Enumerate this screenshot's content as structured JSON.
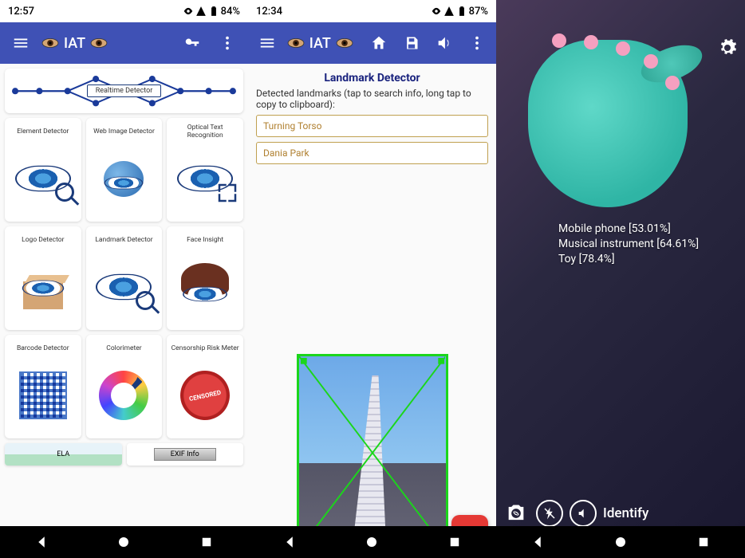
{
  "panel_left": {
    "status": {
      "time": "12:57",
      "battery": "84%"
    },
    "app_bar": {
      "title": "IAT"
    },
    "realtime": {
      "label": "Realtime Detector"
    },
    "cards": [
      {
        "title": "Element Detector"
      },
      {
        "title": "Web Image Detector"
      },
      {
        "title": "Optical Text Recognition"
      },
      {
        "title": "Logo Detector"
      },
      {
        "title": "Landmark Detector"
      },
      {
        "title": "Face Insight"
      },
      {
        "title": "Barcode Detector"
      },
      {
        "title": "Colorimeter"
      },
      {
        "title": "Censorship Risk Meter"
      }
    ],
    "bottom": [
      {
        "label": "ELA"
      },
      {
        "label": "EXIF Info"
      }
    ]
  },
  "panel_mid": {
    "status": {
      "time": "12:34",
      "battery": "87%"
    },
    "app_bar": {
      "title": "IAT"
    },
    "section_title": "Landmark Detector",
    "subtitle": "Detected landmarks (tap to search info, long tap to copy to clipboard):",
    "landmarks": [
      {
        "name": "Turning Torso"
      },
      {
        "name": "Dania Park"
      }
    ]
  },
  "panel_right": {
    "status": {
      "time": "",
      "battery": ""
    },
    "detections": [
      "Mobile phone [53.01%]",
      "Musical instrument [64.61%]",
      "Toy [78.4%]"
    ],
    "action_label": "Identify"
  }
}
